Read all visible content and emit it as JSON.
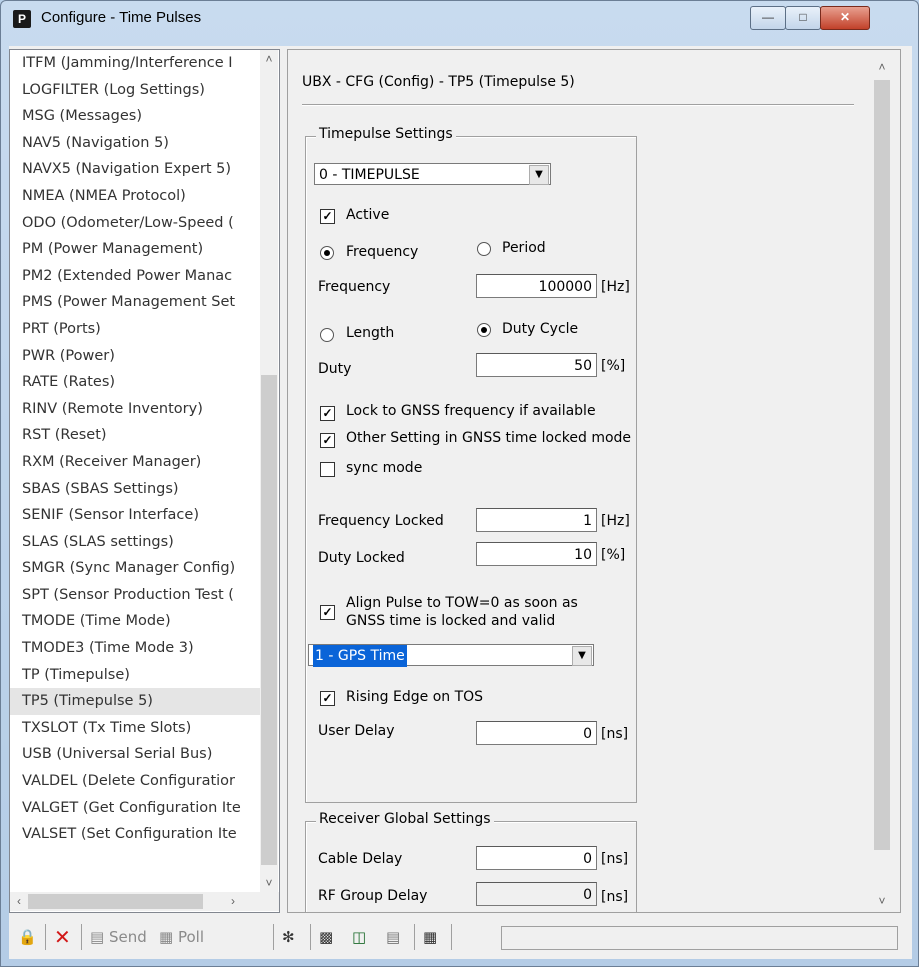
{
  "window": {
    "title": "Configure - Time Pulses",
    "app_icon": "P"
  },
  "list_items": [
    "ITFM (Jamming/Interference I",
    "LOGFILTER (Log Settings)",
    "MSG (Messages)",
    "NAV5 (Navigation 5)",
    "NAVX5 (Navigation Expert 5)",
    "NMEA (NMEA Protocol)",
    "ODO (Odometer/Low-Speed (",
    "PM (Power Management)",
    "PM2 (Extended Power Manac",
    "PMS (Power Management Set",
    "PRT (Ports)",
    "PWR (Power)",
    "RATE (Rates)",
    "RINV (Remote Inventory)",
    "RST (Reset)",
    "RXM (Receiver Manager)",
    "SBAS (SBAS Settings)",
    "SENIF (Sensor Interface)",
    "SLAS (SLAS settings)",
    "SMGR (Sync Manager Config)",
    "SPT (Sensor Production Test (",
    "TMODE (Time Mode)",
    "TMODE3 (Time Mode 3)",
    "TP (Timepulse)",
    "TP5 (Timepulse 5)",
    "TXSLOT (Tx Time Slots)",
    "USB (Universal Serial Bus)",
    "VALDEL (Delete Configuratior",
    "VALGET (Get Configuration Ite",
    "VALSET (Set Configuration Ite"
  ],
  "selected_index": 24,
  "panel": {
    "header": "UBX - CFG (Config) - TP5 (Timepulse 5)",
    "timepulse": {
      "group_label": "Timepulse Settings",
      "pulse_select": "0 - TIMEPULSE",
      "active_label": "Active",
      "frequency_radio": "Frequency",
      "period_radio": "Period",
      "frequency_label": "Frequency",
      "frequency_value": "100000",
      "frequency_unit": "[Hz]",
      "length_radio": "Length",
      "duty_cycle_radio": "Duty Cycle",
      "duty_label": "Duty",
      "duty_value": "50",
      "duty_unit": "[%]",
      "lock_gnss": "Lock to GNSS frequency if available",
      "other_setting": "Other Setting in GNSS time locked mode",
      "sync_mode": "sync mode",
      "freq_locked_label": "Frequency Locked",
      "freq_locked_value": "1",
      "freq_locked_unit": "[Hz]",
      "duty_locked_label": "Duty Locked",
      "duty_locked_value": "10",
      "duty_locked_unit": "[%]",
      "align_line1": "Align Pulse to TOW=0 as soon as",
      "align_line2": "GNSS time is locked and valid",
      "time_select": "1 - GPS Time",
      "rising_edge": "Rising Edge on TOS",
      "user_delay_label": "User Delay",
      "user_delay_value": "0",
      "user_delay_unit": "[ns]"
    },
    "receiver": {
      "group_label": "Receiver Global Settings",
      "cable_delay_label": "Cable Delay",
      "cable_delay_value": "0",
      "cable_delay_unit": "[ns]",
      "rf_delay_label": "RF Group Delay",
      "rf_delay_value": "0",
      "rf_delay_unit": "[ns]"
    }
  },
  "toolbar": {
    "send_label": "Send",
    "poll_label": "Poll"
  },
  "icons": [
    "lock-icon",
    "delete-icon",
    "send-icon",
    "poll-icon",
    "satellite-icon",
    "copy-icon",
    "load-icon",
    "save-icon",
    "device-icon"
  ]
}
